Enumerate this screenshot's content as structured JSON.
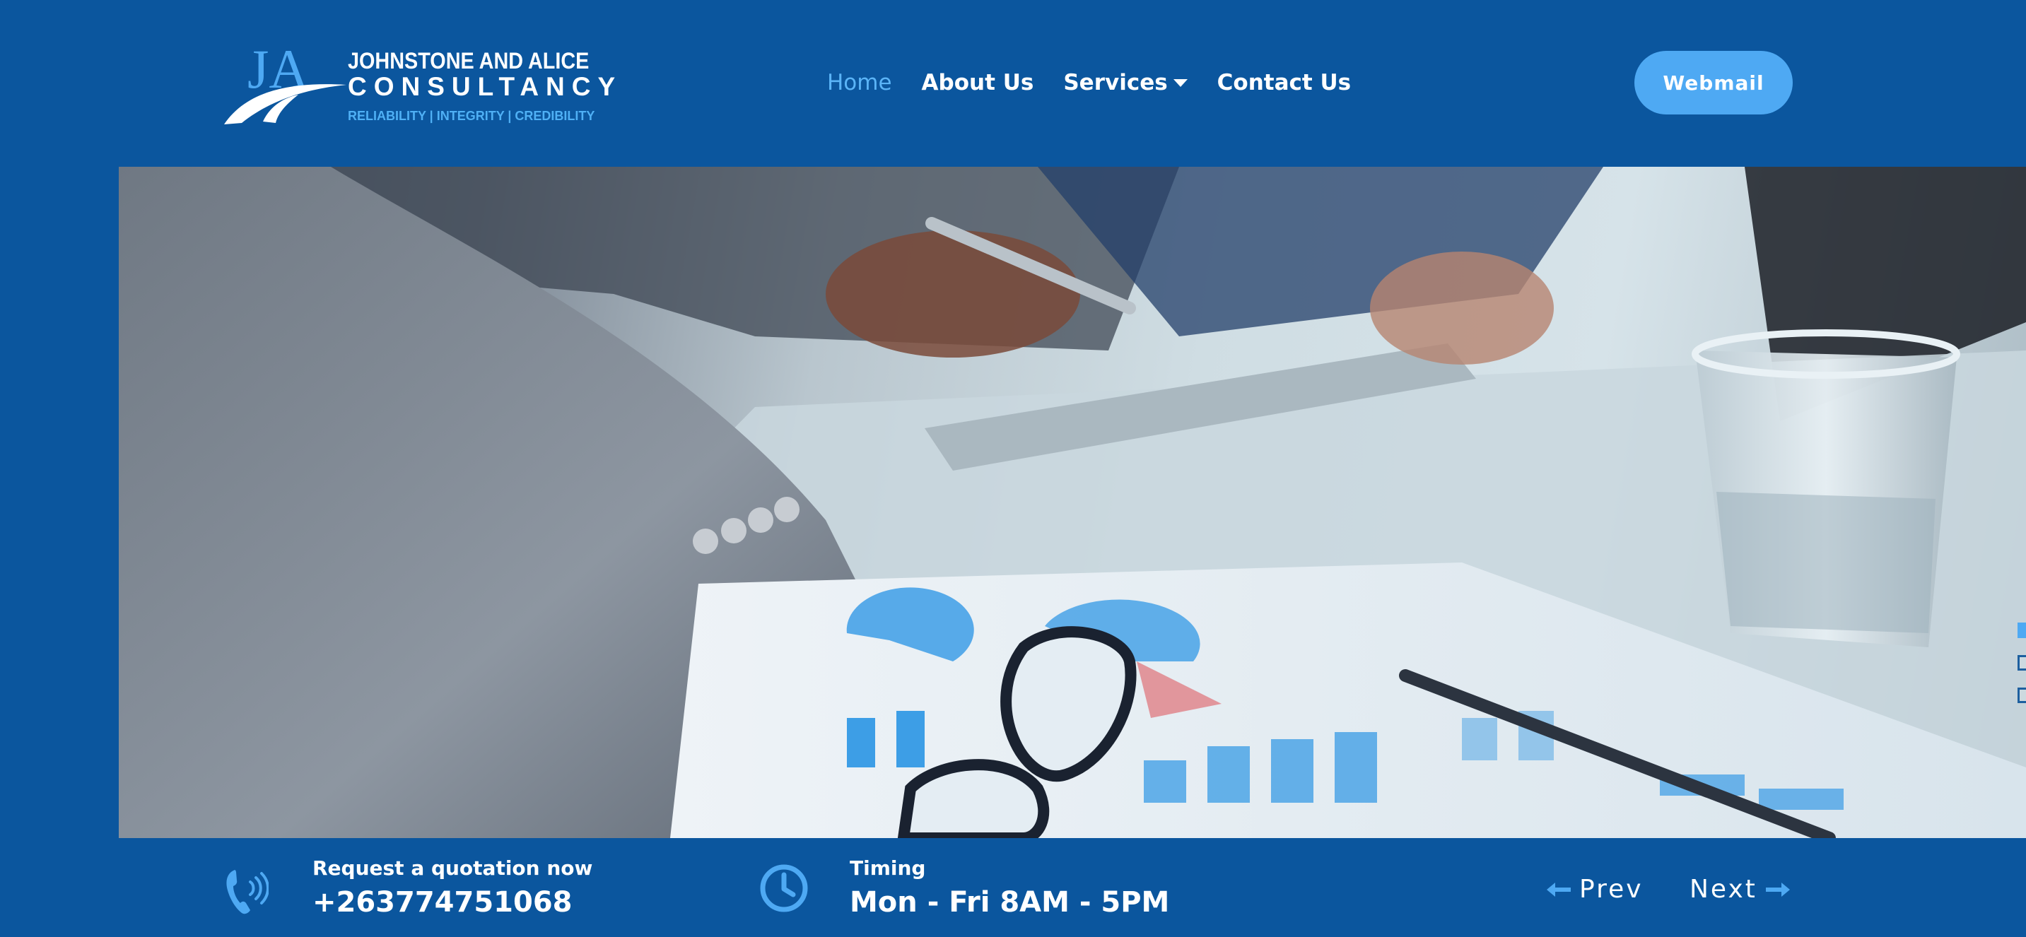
{
  "brand": {
    "monogram": "JA",
    "name_line1": "JOHNSTONE AND ALICE",
    "name_line2": "CONSULTANCY",
    "tagline": "RELIABILITY | INTEGRITY | CREDIBILITY",
    "accent_color": "#4ea9f3",
    "background_color": "#0b569e"
  },
  "nav": {
    "items": [
      {
        "label": "Home",
        "active": true
      },
      {
        "label": "About Us",
        "active": false
      },
      {
        "label": "Services",
        "active": false,
        "has_dropdown": true
      },
      {
        "label": "Contact Us",
        "active": false
      }
    ],
    "webmail_label": "Webmail"
  },
  "hero": {
    "image": "business-meeting-with-charts-glasses-pen-and-glass-of-water",
    "slide_count": 3,
    "active_slide": 1
  },
  "footer_bar": {
    "quote_icon": "phone-icon",
    "quote_label": "Request a quotation now",
    "quote_phone": "+263774751068",
    "timing_icon": "clock-icon",
    "timing_label": "Timing",
    "timing_value": "Mon - Fri 8AM - 5PM",
    "prev_label": "Prev",
    "next_label": "Next"
  }
}
